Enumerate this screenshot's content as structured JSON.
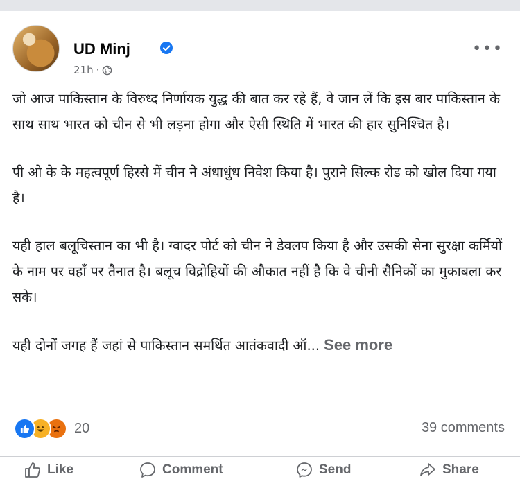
{
  "post": {
    "author_name": "UD Minj",
    "time": "21h",
    "separator": "·",
    "more_label": "•••",
    "paragraphs": [
      "जो आज पाकिस्तान के विरुध्द निर्णायक युद्ध की बात कर रहे हैं, वे जान लें कि इस बार पाकिस्तान के साथ साथ भारत को चीन से भी लड़ना होगा और ऐसी स्थिति में भारत की हार सुनिश्चित है।",
      "पी ओ के के महत्वपूर्ण हिस्से में चीन ने अंधाधुंध निवेश किया है। पुराने सिल्क रोड को खोल दिया गया है।",
      "यही हाल बलूचिस्तान का भी है। ग्वादर पोर्ट को चीन ने डेवलप किया है और उसकी सेना सुरक्षा कर्मियों के नाम पर वहाँ पर तैनात है। बलूच विद्रोहियों की औकात नहीं है कि वे चीनी सैनिकों का मुकाबला कर सके।",
      "यही दोनों जगह हैं जहां से पाकिस्तान समर्थित आतंकवादी ऑ..."
    ],
    "see_more": "See more",
    "reaction_count": "20",
    "comments_count": "39 comments"
  },
  "actions": {
    "like": "Like",
    "comment": "Comment",
    "send": "Send",
    "share": "Share"
  },
  "colors": {
    "accent": "#1877f2",
    "muted": "#65676b"
  },
  "icons": [
    "verified-badge-icon",
    "globe-icon",
    "like-reaction-icon",
    "haha-reaction-icon",
    "angry-reaction-icon",
    "thumbs-up-icon",
    "comment-bubble-icon",
    "messenger-icon",
    "share-arrow-icon"
  ]
}
